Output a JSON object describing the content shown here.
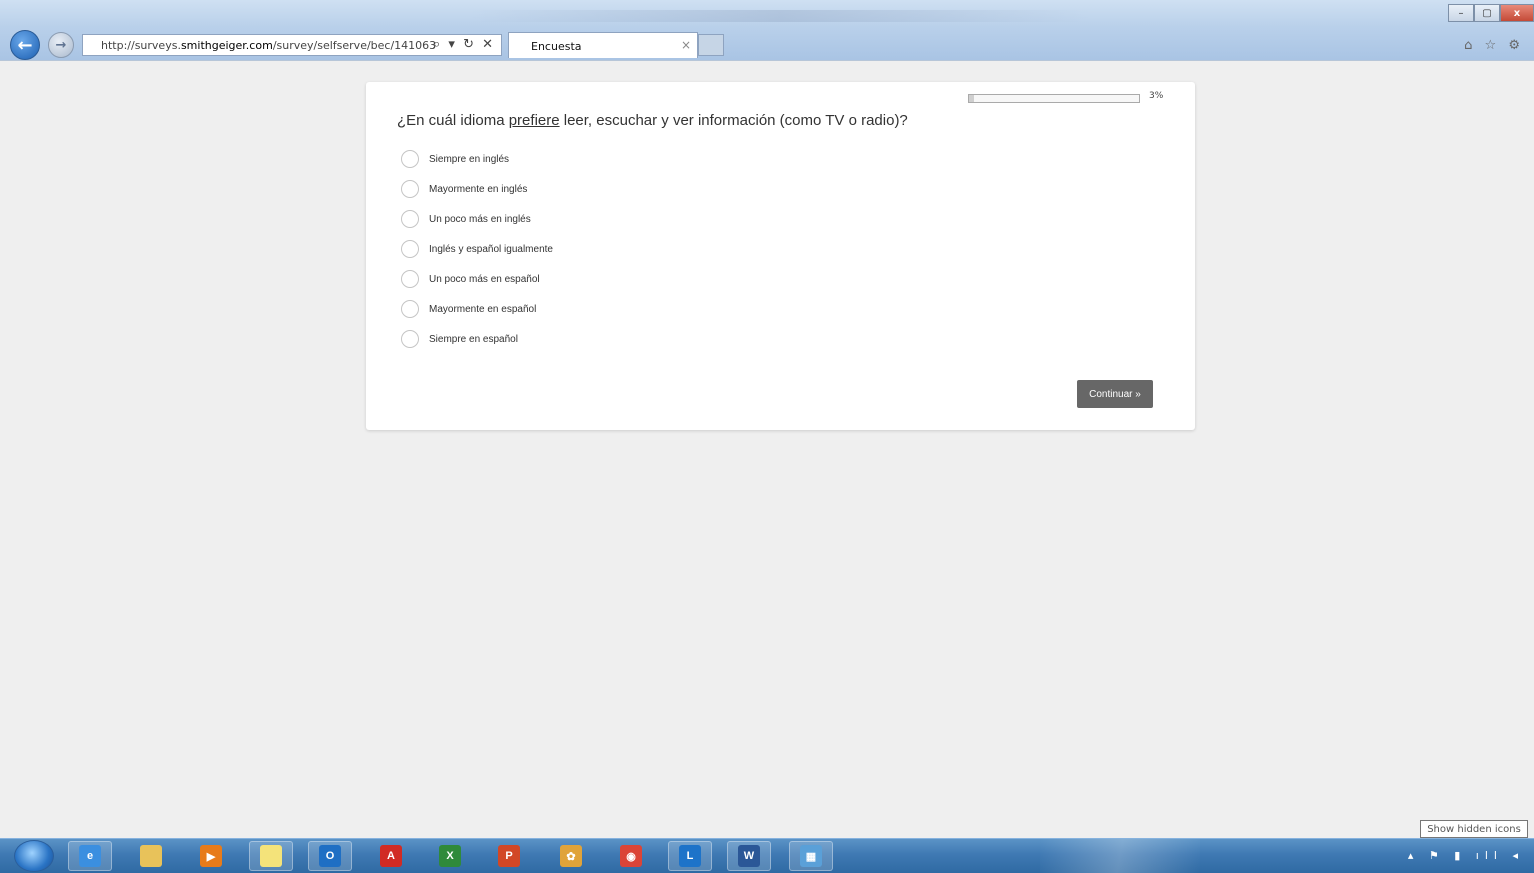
{
  "browser": {
    "url_prefix": "http://surveys.",
    "url_domain": "smithgeiger.com",
    "url_path": "/survey/selfserve/bec/141063",
    "address_tools": "⌕ ▾ ↻ ✕",
    "tab_title": "Encuesta",
    "tab_close": "×",
    "back_glyph": "←",
    "forward_glyph": "→",
    "window_controls": [
      "–",
      "▢",
      "x"
    ],
    "right_icons": "⌂ ☆ ⚙"
  },
  "survey": {
    "progress_percent": 3,
    "progress_label": "3%",
    "question_pre": "¿En cuál idioma ",
    "question_emphasis": "prefiere",
    "question_post": " leer, escuchar y ver información (como TV o radio)?",
    "options": [
      "Siempre en inglés",
      "Mayormente en inglés",
      "Un poco más en inglés",
      "Inglés y español igualmente",
      "Un poco más en español",
      "Mayormente en español",
      "Siempre en español"
    ],
    "continue_label": "Continuar »"
  },
  "taskbar": {
    "apps": [
      {
        "name": "internet-explorer-icon",
        "glyph": "e",
        "color": "#3b8fe0",
        "active": true
      },
      {
        "name": "file-explorer-icon",
        "glyph": "",
        "color": "#e8c25a",
        "active": false
      },
      {
        "name": "media-player-icon",
        "glyph": "▶",
        "color": "#e77b1a",
        "active": false
      },
      {
        "name": "sticky-notes-icon",
        "glyph": "",
        "color": "#f4e37a",
        "active": true
      },
      {
        "name": "outlook-icon",
        "glyph": "O",
        "color": "#1f6fc4",
        "active": true
      },
      {
        "name": "acrobat-icon",
        "glyph": "A",
        "color": "#d12b24",
        "active": false
      },
      {
        "name": "excel-icon",
        "glyph": "X",
        "color": "#2f8a3b",
        "active": false
      },
      {
        "name": "powerpoint-icon",
        "glyph": "P",
        "color": "#d24726",
        "active": false
      },
      {
        "name": "pinwheel-icon",
        "glyph": "✿",
        "color": "#e0a33a",
        "active": false
      },
      {
        "name": "chrome-icon",
        "glyph": "◉",
        "color": "#db4437",
        "active": false
      },
      {
        "name": "lync-icon",
        "glyph": "L",
        "color": "#1d73c9",
        "active": true
      },
      {
        "name": "word-icon",
        "glyph": "W",
        "color": "#2b5797",
        "active": true
      },
      {
        "name": "control-panel-icon",
        "glyph": "▦",
        "color": "#5aa0d8",
        "active": true
      }
    ],
    "tray": "▴ ⚑ ▮ ıll ◂",
    "tooltip": "Show hidden icons"
  }
}
